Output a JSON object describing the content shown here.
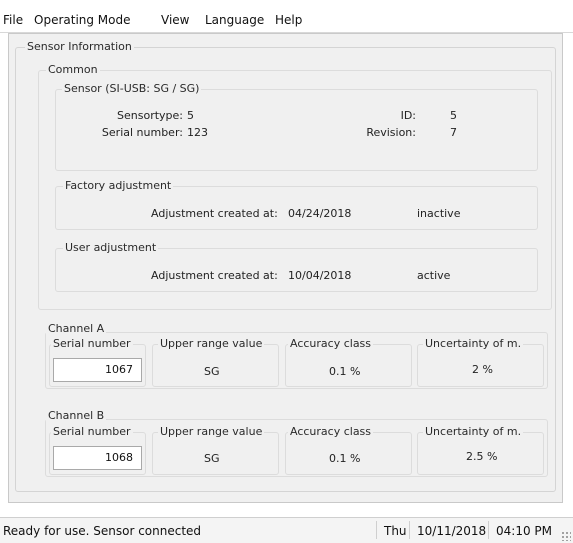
{
  "menu": {
    "items": [
      "File",
      "Operating Mode",
      "View",
      "Language",
      "Help"
    ]
  },
  "sensor_information": {
    "title": "Sensor Information",
    "common": {
      "title": "Common",
      "sensor": {
        "title": "Sensor (SI-USB: SG / SG)",
        "sensortype_label": "Sensortype:",
        "sensortype_value": "5",
        "serial_label": "Serial number:",
        "serial_value": "123",
        "id_label": "ID:",
        "id_value": "5",
        "revision_label": "Revision:",
        "revision_value": "7"
      },
      "factory": {
        "title": "Factory adjustment",
        "created_label": "Adjustment created at:",
        "created_date": "04/24/2018",
        "status": "inactive"
      },
      "user": {
        "title": "User adjustment",
        "created_label": "Adjustment created at:",
        "created_date": "10/04/2018",
        "status": "active"
      }
    },
    "channel_a": {
      "title": "Channel A",
      "serial_label": "Serial number",
      "serial_value": "1067",
      "upper_label": "Upper range value",
      "upper_value": "SG",
      "accuracy_label": "Accuracy class",
      "accuracy_value": "0.1 %",
      "uncertainty_label": "Uncertainty of m.",
      "uncertainty_value": "2 %"
    },
    "channel_b": {
      "title": "Channel B",
      "serial_label": "Serial number",
      "serial_value": "1068",
      "upper_label": "Upper range value",
      "upper_value": "SG",
      "accuracy_label": "Accuracy class",
      "accuracy_value": "0.1 %",
      "uncertainty_label": "Uncertainty of m.",
      "uncertainty_value": "2.5 %"
    }
  },
  "status_bar": {
    "message": "Ready for use. Sensor connected",
    "day": "Thu",
    "date": "10/11/2018",
    "time": "04:10 PM"
  }
}
